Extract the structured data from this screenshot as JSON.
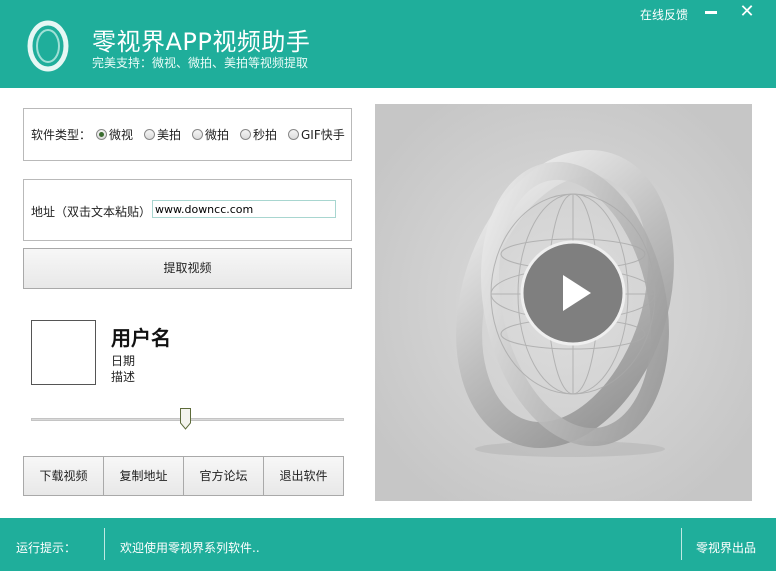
{
  "header": {
    "title": "零视界APP视频助手",
    "subtitle": "完美支持：微视、微拍、美拍等视频提取",
    "feedback": "在线反馈",
    "close_glyph": "✕",
    "logo_icon": "ring-logo-icon",
    "accent_color": "#1fae9b"
  },
  "software_type": {
    "label": "软件类型：",
    "options": [
      {
        "label": "微视",
        "selected": true
      },
      {
        "label": "美拍",
        "selected": false
      },
      {
        "label": "微拍",
        "selected": false
      },
      {
        "label": "秒拍",
        "selected": false
      },
      {
        "label": "GIF快手",
        "selected": false
      }
    ]
  },
  "address": {
    "label": "地址（双击文本粘贴）",
    "value": "www.downcc.com"
  },
  "fetch_button": "提取视频",
  "user": {
    "name": "用户名",
    "date": "日期",
    "description": "描述"
  },
  "progress": 0.495,
  "buttons": {
    "download": "下载视频",
    "copy": "复制地址",
    "forum": "官方论坛",
    "exit": "退出软件"
  },
  "preview": {
    "play_icon": "play-icon"
  },
  "footer": {
    "status_label": "运行提示：",
    "status_message": "欢迎使用零视界系列软件..",
    "brand": "零视界出品"
  }
}
